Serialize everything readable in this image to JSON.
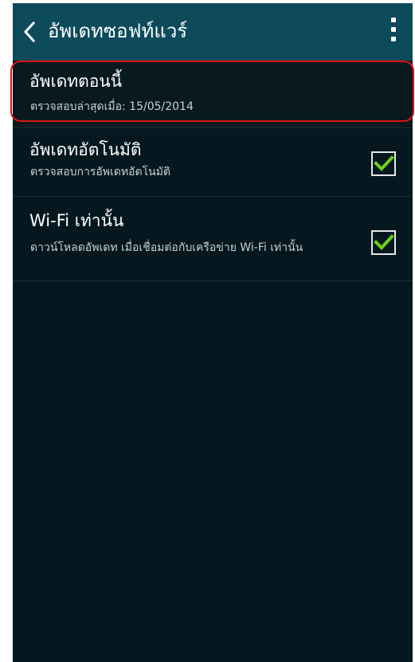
{
  "action_bar": {
    "title": "อัพเดทซอฟท์แวร์",
    "back_icon": "chevron-left-icon",
    "more_icon": "overflow-menu-icon"
  },
  "items": [
    {
      "title": "อัพเดทตอนนี้",
      "subtitle": "ตรวจสอบล่าสุดเมื่อ: 15/05/2014",
      "highlighted": true
    },
    {
      "title": "อัพเดทอัตโนมัติ",
      "subtitle": "ตรวจสอบการอัพเดทอัตโนมัติ",
      "checked": true
    },
    {
      "title": "Wi-Fi เท่านั้น",
      "subtitle": "ดาวน์โหลดอัพเดท เมื่อเชื่อมต่อกับเครือข่าย Wi-Fi เท่านั้น",
      "checked": true
    }
  ],
  "colors": {
    "action_bar": "#0d4a5a",
    "background": "#05181f",
    "check_green": "#6bd11a",
    "highlight_red": "#e01212"
  }
}
